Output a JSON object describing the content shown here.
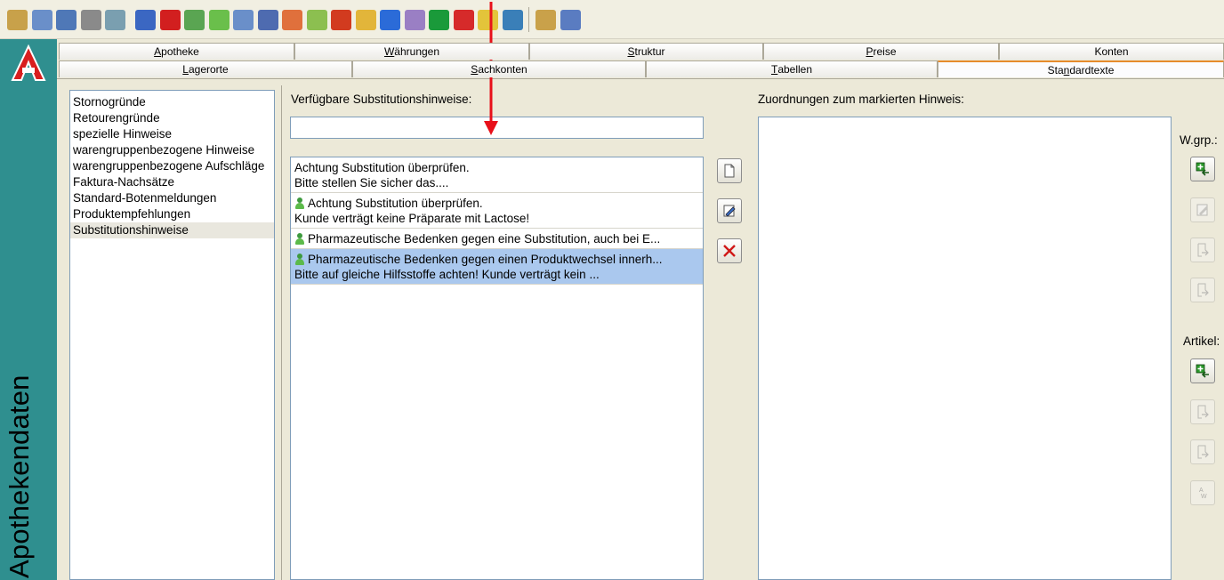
{
  "brand": {
    "vertical_title": "Apothekendaten"
  },
  "toolbar": {
    "icons": [
      "pharmacy-a-icon",
      "people-icon",
      "card-icon",
      "network-icon",
      "cabinet-icon",
      "edit-icon",
      "alert-icon",
      "users-icon",
      "notes-icon",
      "cart-icon",
      "barcode-icon",
      "tablets-icon",
      "list-icon",
      "pie-chart-icon",
      "mail-icon",
      "shoe-icon",
      "wrench-icon",
      "at-icon",
      "cross-icon",
      "euro-icon",
      "phone-icon",
      "gear-icon",
      "clock-icon"
    ]
  },
  "tabs_row1": [
    {
      "label": "Apotheke",
      "u": "A"
    },
    {
      "label": "Währungen",
      "u": "W"
    },
    {
      "label": "Struktur",
      "u": "S"
    },
    {
      "label": "Preise",
      "u": "P"
    },
    {
      "label": "Konten",
      "u": ""
    }
  ],
  "tabs_row2": [
    {
      "label": "Lagerorte",
      "u": "L"
    },
    {
      "label": "Sachkonten",
      "u": "S"
    },
    {
      "label": "Tabellen",
      "u": "T"
    },
    {
      "label": "Standardtexte",
      "u": "n",
      "active": true
    }
  ],
  "categories": {
    "items": [
      "Stornogründe",
      "Retourengründe",
      "spezielle Hinweise",
      "warengruppenbezogene Hinweise",
      "warengruppenbezogene Aufschläge",
      "Faktura-Nachsätze",
      "Standard-Botenmeldungen",
      "Produktempfehlungen",
      "Substitutionshinweise"
    ],
    "selected_index": 8
  },
  "available": {
    "label": "Verfügbare Substitutionshinweise:",
    "search_value": "",
    "hints": [
      {
        "line1": "Achtung Substitution überprüfen.",
        "line2": "Bitte stellen Sie sicher das....",
        "icon": false,
        "selected": false
      },
      {
        "line1": "Achtung Substitution überprüfen.",
        "line2": "Kunde verträgt keine Präparate mit Lactose!",
        "icon": true,
        "selected": false
      },
      {
        "line1": "Pharmazeutische Bedenken gegen eine Substitution, auch bei E...",
        "line2": "",
        "icon": true,
        "selected": false
      },
      {
        "line1": "Pharmazeutische Bedenken gegen einen Produktwechsel innerh...",
        "line2": "Bitte auf gleiche Hilfsstoffe achten! Kunde verträgt kein ...",
        "icon": true,
        "selected": true
      }
    ]
  },
  "assignments": {
    "label": "Zuordnungen zum markierten Hinweis:",
    "wgrp_label": "W.grp.:",
    "artikel_label": "Artikel:"
  },
  "colors": {
    "brand_bar": "#2f8f8f",
    "selection": "#aac8ee",
    "active_tab_accent": "#e68b2c",
    "annotation_arrow": "#e8101a"
  }
}
